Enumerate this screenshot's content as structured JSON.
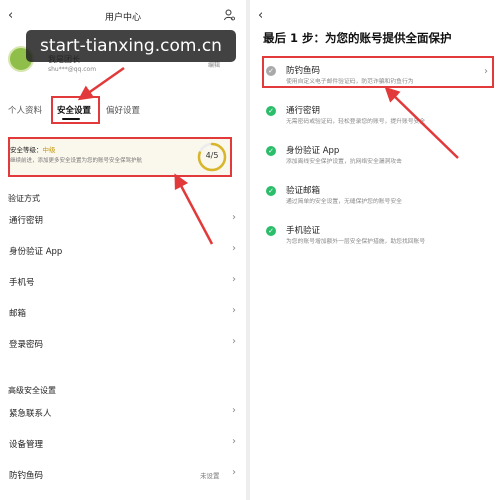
{
  "left": {
    "back_icon": "chevron-left-icon",
    "title": "用户中心",
    "header_icon": "user-settings-icon",
    "profile": {
      "nickname": "我是团长",
      "email": "shu***@qq.com",
      "edit_label": "编辑"
    },
    "tabs": [
      {
        "label": "个人资料"
      },
      {
        "label": "安全设置"
      },
      {
        "label": "偏好设置"
      }
    ],
    "security": {
      "level_label": "安全等级：",
      "level_value": "中级",
      "desc": "继续前进，添加更多安全设置为您的账号安全保驾护航",
      "score": "4/5",
      "score_fraction": 0.8
    },
    "verification": {
      "header": "验证方式",
      "items": [
        {
          "label": "通行密钥"
        },
        {
          "label": "身份验证 App"
        },
        {
          "label": "手机号"
        },
        {
          "label": "邮箱"
        },
        {
          "label": "登录密码"
        }
      ]
    },
    "advanced": {
      "header": "高级安全设置",
      "items": [
        {
          "label": "紧急联系人",
          "value": ""
        },
        {
          "label": "设备管理",
          "value": ""
        },
        {
          "label": "防钓鱼码",
          "value": "未设置"
        }
      ]
    }
  },
  "watermark": "start-tianxing.com.cn",
  "right": {
    "back_icon": "chevron-left-icon",
    "title": "最后 1 步：为您的账号提供全面保护",
    "options": [
      {
        "title": "防钓鱼码",
        "desc": "使用自定义电子邮件验证码，防范诈骗和钓鱼行为",
        "icon": "grey-check-icon",
        "done": false
      },
      {
        "title": "通行密钥",
        "desc": "无需密码或验证码，轻松登录您的账号，提升账号安全",
        "icon": "green-check-icon",
        "done": true
      },
      {
        "title": "身份验证 App",
        "desc": "添加离线安全保护设置，抗网络安全漏洞攻击",
        "icon": "green-check-icon",
        "done": true
      },
      {
        "title": "验证邮箱",
        "desc": "通过简单的安全设置，无缝保护您的账号安全",
        "icon": "green-check-icon",
        "done": true
      },
      {
        "title": "手机验证",
        "desc": "为您的账号增加额外一层安全保护措施，助您找回账号",
        "icon": "green-check-icon",
        "done": true
      }
    ]
  },
  "colors": {
    "highlight": "#e23a3a",
    "gold": "#c39a12",
    "green": "#2bbd6a"
  }
}
